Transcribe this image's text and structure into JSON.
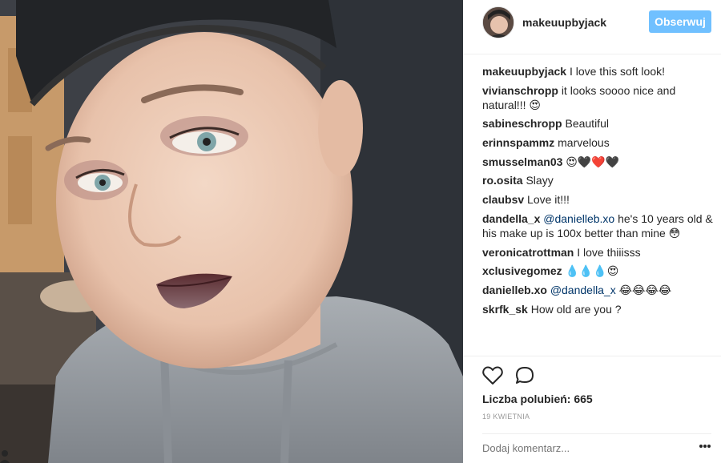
{
  "post": {
    "username": "makeuupbyjack",
    "follow_label": "Obserwuj",
    "likes_text": "Liczba polubień: 665",
    "date": "19 kwietnia",
    "add_comment_placeholder": "Dodaj komentarz...",
    "comments": [
      {
        "user": "makeuupbyjack",
        "text": "I love this soft look!"
      },
      {
        "user": "vivianschropp",
        "text": "it looks soooo nice and natural!!! 😍"
      },
      {
        "user": "sabineschropp",
        "text": "Beautiful"
      },
      {
        "user": "erinnspammz",
        "text": "marvelous"
      },
      {
        "user": "smusselman03",
        "text": "😍🖤❤️🖤"
      },
      {
        "user": "ro.osita",
        "text": "Slayy"
      },
      {
        "user": "claubsv",
        "text": "Love it!!!"
      },
      {
        "user": "dandella_x",
        "mention": "@danielleb.xo",
        "text": "he's 10 years old & his make up is 100x better than mine 😳"
      },
      {
        "user": "veronicatrottman",
        "text": "I love thiiisss"
      },
      {
        "user": "xclusivegomez",
        "text": "💧💧💧😍"
      },
      {
        "user": "danielleb.xo",
        "mention": "@dandella_x",
        "text": "😂😂😂😂"
      },
      {
        "user": "skrfk_sk",
        "text": "How old are you ?"
      }
    ]
  },
  "icons": {
    "heart": "heart-icon",
    "comment": "comment-icon",
    "more": "more-options-icon"
  },
  "colors": {
    "follow_button": "#70c0ff",
    "mention": "#003569",
    "muted": "#999999"
  }
}
